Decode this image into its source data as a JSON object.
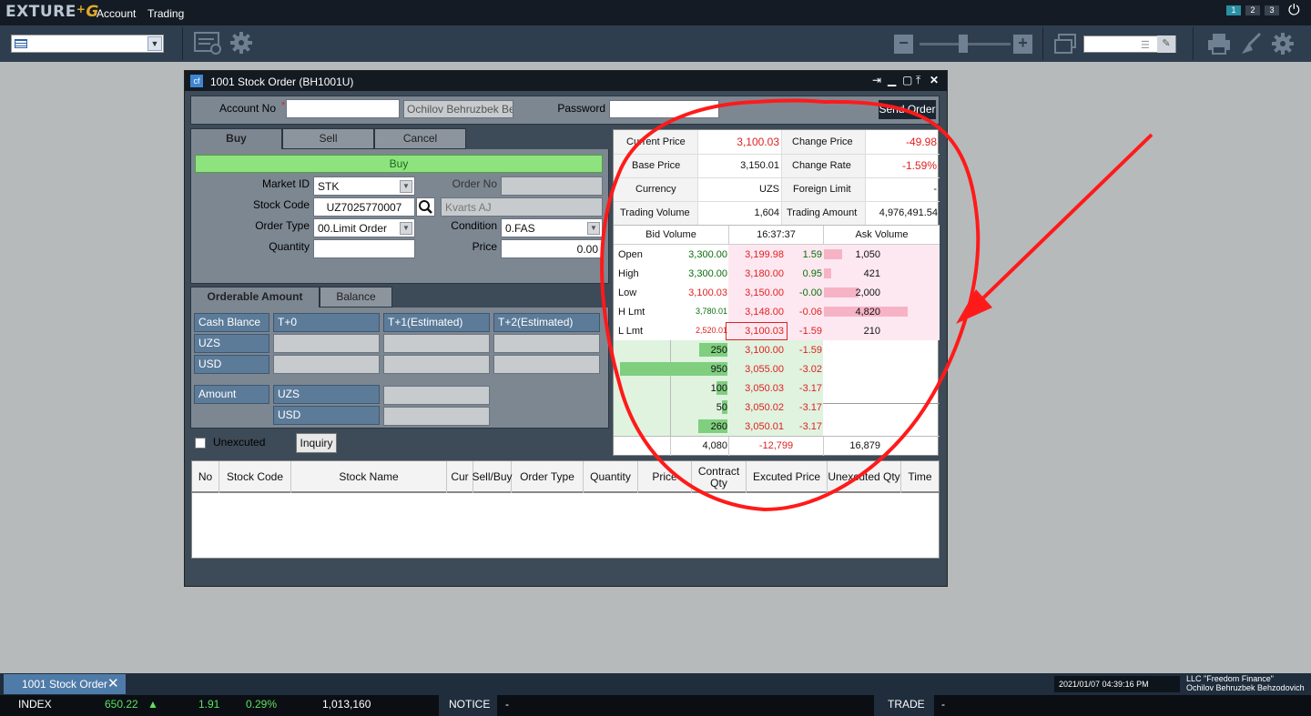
{
  "topbar": {
    "logo_text": "EXTURE",
    "logo_plus": "+",
    "menu": [
      "Account",
      "Trading"
    ],
    "screens": [
      "1",
      "2",
      "3"
    ],
    "power_icon": "power-icon"
  },
  "toolbar": {
    "icons": [
      "list-add-icon",
      "gear-icon",
      "zoom-out-icon",
      "zoom-in-icon",
      "window-icon",
      "list-icon",
      "wrench-icon",
      "printer-icon",
      "broom-icon",
      "settings-icon"
    ]
  },
  "window": {
    "title": "1001 Stock Order (BH1001U)",
    "cf_label": "cf",
    "controls": [
      "pin-icon",
      "minimize-icon",
      "maximize-icon",
      "restore-icon",
      "close-icon"
    ]
  },
  "order_header": {
    "account_label": "Account No",
    "required_mark": "*",
    "account_value": "",
    "account_name": "Ochilov Behruzbek Beh",
    "password_label": "Password",
    "password_value": "",
    "send_button": "Send Order"
  },
  "order_tabs": [
    "Buy",
    "Sell",
    "Cancel"
  ],
  "order_form": {
    "buy_banner": "Buy",
    "market_id_label": "Market ID",
    "market_id_value": "STK",
    "order_no_label": "Order No",
    "order_no_value": "",
    "stock_code_label": "Stock Code",
    "stock_code_value": "UZ7025770007",
    "stock_name_value": "Kvarts AJ",
    "order_type_label": "Order Type",
    "order_type_value": "00.Limit Order",
    "condition_label": "Condition",
    "condition_value": "0.FAS",
    "quantity_label": "Quantity",
    "quantity_value": "",
    "price_label": "Price",
    "price_value": "0.00"
  },
  "amount_tabs": [
    "Orderable Amount",
    "Balance"
  ],
  "amount_table": {
    "headers": [
      "Cash Blance",
      "T+0",
      "T+1(Estimated)",
      "T+2(Estimated)"
    ],
    "rows": [
      "UZS",
      "USD"
    ],
    "amount_label": "Amount",
    "amount_rows": [
      "UZS",
      "USD"
    ]
  },
  "unexecuted": {
    "checkbox_label": "Unexcuted",
    "checked": false,
    "inquiry_button": "Inquiry"
  },
  "quote": {
    "current_price_label": "Current Price",
    "current_price": "3,100.03",
    "change_price_label": "Change Price",
    "change_price": "-49.98",
    "base_price_label": "Base Price",
    "base_price": "3,150.01",
    "change_rate_label": "Change Rate",
    "change_rate": "-1.59%",
    "currency_label": "Currency",
    "currency": "UZS",
    "foreign_limit_label": "Foreign Limit",
    "foreign_limit": "-",
    "trading_volume_label": "Trading Volume",
    "trading_volume": "1,604",
    "trading_amount_label": "Trading Amount",
    "trading_amount": "4,976,491.54",
    "book_headers": [
      "Bid Volume",
      "16:37:37",
      "Ask Volume"
    ],
    "ask_side": [
      {
        "label": "Open",
        "label_value": "3,300.00",
        "price": "3,199.98",
        "change": "1.59",
        "ask_volume": "1,050",
        "ask_fill": 0.22
      },
      {
        "label": "High",
        "label_value": "3,300.00",
        "price": "3,180.00",
        "change": "0.95",
        "ask_volume": "421",
        "ask_fill": 0.09
      },
      {
        "label": "Low",
        "label_value": "3,100.03",
        "price": "3,150.00",
        "change": "-0.00",
        "ask_volume": "2,000",
        "ask_fill": 0.41
      },
      {
        "label": "H Lmt",
        "label_value": "3,780.01",
        "price": "3,148.00",
        "change": "-0.06",
        "ask_volume": "4,820",
        "ask_fill": 1.0
      },
      {
        "label": "L Lmt",
        "label_value": "2,520.01",
        "price": "3,100.03",
        "change": "-1.59",
        "ask_volume": "210",
        "ask_fill": 0.0
      }
    ],
    "bid_side": [
      {
        "bid_volume": "250",
        "price": "3,100.00",
        "change": "-1.59",
        "bid_fill": 0.26
      },
      {
        "bid_volume": "950",
        "price": "3,055.00",
        "change": "-3.02",
        "bid_fill": 1.0
      },
      {
        "bid_volume": "100",
        "price": "3,050.03",
        "change": "-3.17",
        "bid_fill": 0.1
      },
      {
        "bid_volume": "50",
        "price": "3,050.02",
        "change": "-3.17",
        "bid_fill": 0.05
      },
      {
        "bid_volume": "260",
        "price": "3,050.01",
        "change": "-3.17",
        "bid_fill": 0.27
      }
    ],
    "total_bid": "4,080",
    "total_diff": "-12,799",
    "total_ask": "16,879"
  },
  "order_grid": {
    "columns": [
      "No",
      "Stock Code",
      "Stock Name",
      "Cur",
      "Sell/Buy",
      "Order Type",
      "Quantity",
      "Price",
      "Contract Qty",
      "Excuted Price",
      "Unexcuted Qty",
      "Time"
    ],
    "rows": []
  },
  "taskbar": {
    "tab_label": "1001 Stock Order",
    "datetime": "2021/01/07 04:39:16 PM",
    "company": "LLC \"Freedom Finance\"",
    "user": "Ochilov Behruzbek Behzodovich"
  },
  "ticker": {
    "index_label": "INDEX",
    "index_value": "650.22",
    "index_arrow": "▲",
    "index_change": "1.91",
    "index_rate": "0.29%",
    "index_volume": "1,013,160",
    "notice_label": "NOTICE",
    "notice_value": "-",
    "trade_label": "TRADE",
    "trade_value": "-"
  },
  "colors": {
    "accent_red": "#e02020",
    "bid_green": "#7fcf7f",
    "ask_pink": "#f7b3c6",
    "annotation_red": "#ff1a1a"
  }
}
